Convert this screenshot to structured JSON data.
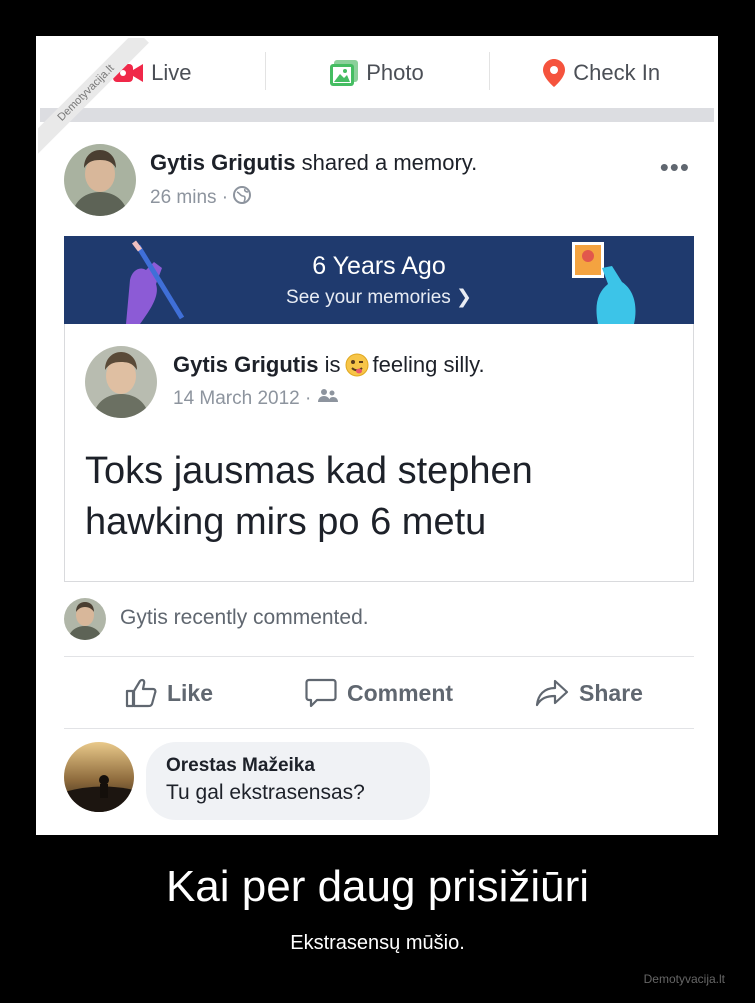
{
  "watermark": "Demotyvacija.lt",
  "composer": {
    "live_label": "Live",
    "photo_label": "Photo",
    "checkin_label": "Check In"
  },
  "post": {
    "author": "Gytis Grigutis",
    "action": "shared a memory.",
    "time": "26 mins",
    "more": "•••"
  },
  "memory_banner": {
    "title": "6 Years Ago",
    "subtitle": "See your memories"
  },
  "memory_post": {
    "author": "Gytis Grigutis",
    "is": "is",
    "feeling": "feeling silly.",
    "date": "14 March 2012",
    "text": "Toks jausmas kad stephen\nhawking mirs po 6 metu"
  },
  "recent_comment": "Gytis recently commented.",
  "actions": {
    "like": "Like",
    "comment": "Comment",
    "share": "Share"
  },
  "comment": {
    "author": "Orestas Mažeika",
    "text": "Tu gal ekstrasensas?"
  },
  "caption": {
    "title": "Kai per daug prisižiūri",
    "subtitle": "Ekstrasensų mūšio.",
    "site": "Demotyvacija.lt"
  },
  "colors": {
    "banner_bg": "#1f3a6e",
    "live_red": "#f02849",
    "photo_green": "#45bd62",
    "checkin_red": "#f5533d"
  }
}
